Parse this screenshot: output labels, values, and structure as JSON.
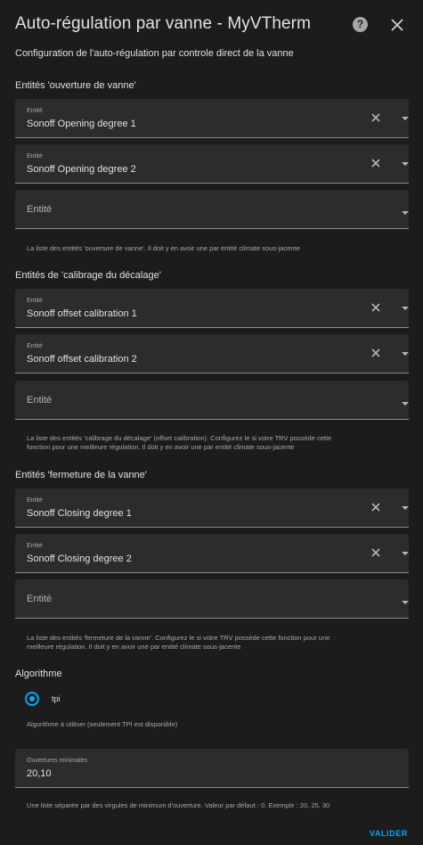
{
  "dialog": {
    "title": "Auto-régulation par vanne - MyVTherm",
    "subtitle": "Configuration de l'auto-régulation par controle direct de la vanne",
    "help_icon_glyph": "?",
    "accent_color": "#03a9f4"
  },
  "opening": {
    "section_title": "Entités 'ouverture de vanne'",
    "fields": [
      {
        "label": "Entité",
        "value": "Sonoff Opening degree 1"
      },
      {
        "label": "Entité",
        "value": "Sonoff Opening degree 2"
      }
    ],
    "empty_placeholder": "Entité",
    "helper": "La liste des entités 'ouverture de vanne'. Il doit y en avoir une par entité climate sous-jacente"
  },
  "offset": {
    "section_title": "Entités de 'calibrage du décalage'",
    "fields": [
      {
        "label": "Entité",
        "value": "Sonoff offset calibration 1"
      },
      {
        "label": "Entité",
        "value": "Sonoff offset calibration 2"
      }
    ],
    "empty_placeholder": "Entité",
    "helper_line1": "La liste des entités 'calibrage du décalage' (offset calibration). Configurez le si votre TRV possède cette",
    "helper_line2": "fonction pour une meilleure régulation. Il doit y en avoir une par entité climate sous-jacente"
  },
  "closing": {
    "section_title": "Entités 'fermeture de la vanne'",
    "fields": [
      {
        "label": "Entité",
        "value": "Sonoff Closing degree 1"
      },
      {
        "label": "Entité",
        "value": "Sonoff Closing degree 2"
      }
    ],
    "empty_placeholder": "Entité",
    "helper_line1": "La liste des entités 'fermeture de la vanne'. Configurez le si votre TRV possède cette fonction pour une",
    "helper_line2": "meilleure régulation. Il doit y en avoir une par entité climate sous-jacente"
  },
  "algorithm": {
    "section_title": "Algorithme",
    "option": "tpi",
    "helper": "Algorithme à utiliser (seulement TPI est disponible)"
  },
  "min_openings": {
    "label": "Ouvertures minimales",
    "value": "20,10",
    "helper": "Une liste séparée par des virgules de minimum d'ouverture. Valeur par défaut : 0. Exemple : 20, 25, 30"
  },
  "actions": {
    "submit": "VALIDER"
  }
}
